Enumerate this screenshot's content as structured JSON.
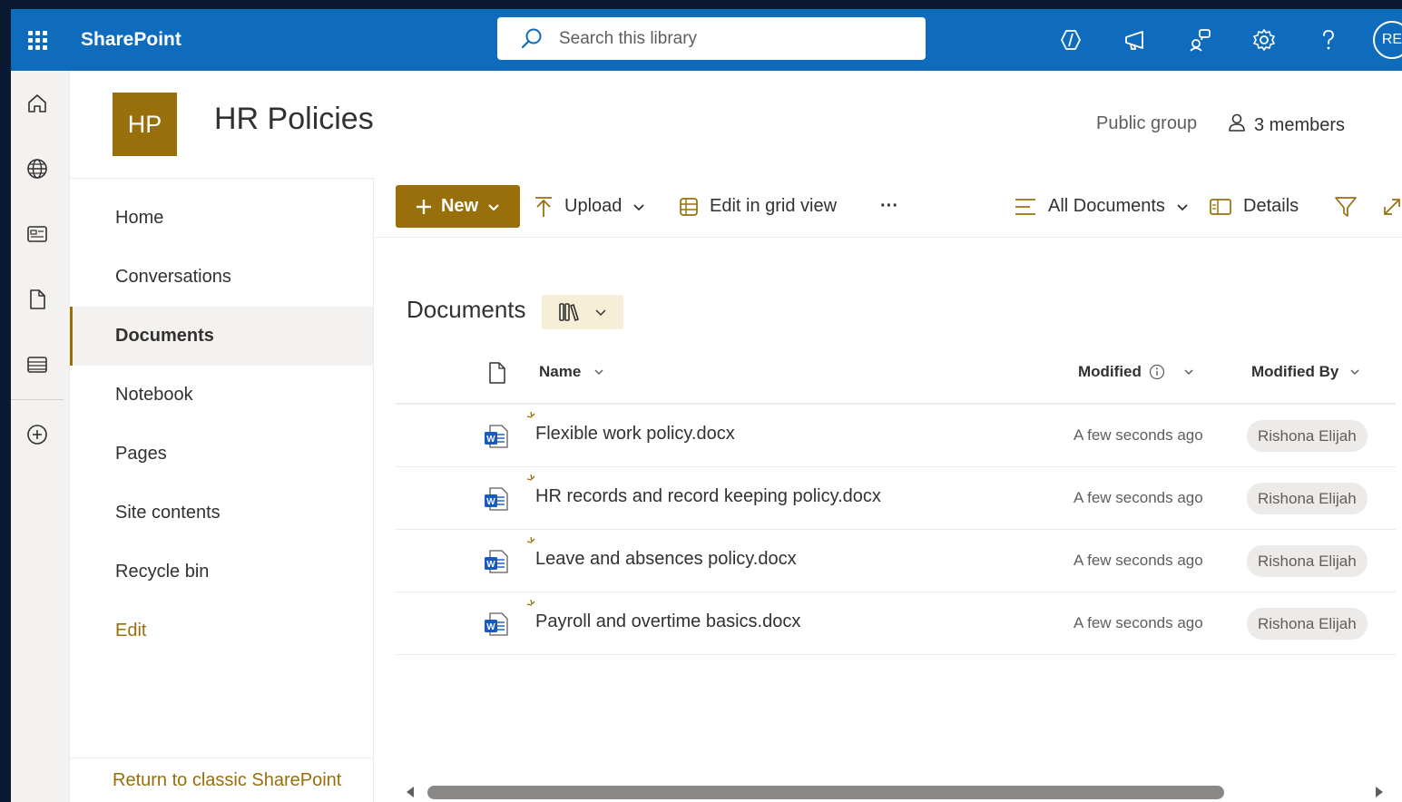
{
  "suite": {
    "app_name": "SharePoint",
    "search_placeholder": "Search this library",
    "avatar_initials": "RE",
    "icons": [
      "waffle-icon",
      "copilot-icon",
      "announcement-icon",
      "share-feedback-icon",
      "gear-icon",
      "help-icon"
    ]
  },
  "rail": {
    "items": [
      "home-icon",
      "globe-icon",
      "news-icon",
      "file-icon",
      "list-icon",
      "create-icon"
    ]
  },
  "site": {
    "logo_initials": "HP",
    "title": "HR Policies",
    "group_type": "Public group",
    "members": "3 members"
  },
  "nav": {
    "items": [
      {
        "label": "Home",
        "active": false
      },
      {
        "label": "Conversations",
        "active": false
      },
      {
        "label": "Documents",
        "active": true
      },
      {
        "label": "Notebook",
        "active": false
      },
      {
        "label": "Pages",
        "active": false
      },
      {
        "label": "Site contents",
        "active": false
      },
      {
        "label": "Recycle bin",
        "active": false
      }
    ],
    "edit_label": "Edit",
    "classic_label": "Return to classic SharePoint"
  },
  "commands": {
    "new_label": "New",
    "upload_label": "Upload",
    "grid_label": "Edit in grid view",
    "more_label": "···",
    "view_label": "All Documents",
    "details_label": "Details"
  },
  "library": {
    "title": "Documents",
    "columns": {
      "name": "Name",
      "modified": "Modified",
      "modified_by": "Modified By"
    },
    "files": [
      {
        "name": "Flexible work policy.docx",
        "modified": "A few seconds ago",
        "modified_by": "Rishona Elijah"
      },
      {
        "name": "HR records and record keeping policy.docx",
        "modified": "A few seconds ago",
        "modified_by": "Rishona Elijah"
      },
      {
        "name": "Leave and absences policy.docx",
        "modified": "A few seconds ago",
        "modified_by": "Rishona Elijah"
      },
      {
        "name": "Payroll and overtime basics.docx",
        "modified": "A few seconds ago",
        "modified_by": "Rishona Elijah"
      }
    ]
  },
  "colors": {
    "suite_bar": "#0f6cbd",
    "accent": "#986f0b",
    "view_switch_bg": "#f6eed7"
  }
}
